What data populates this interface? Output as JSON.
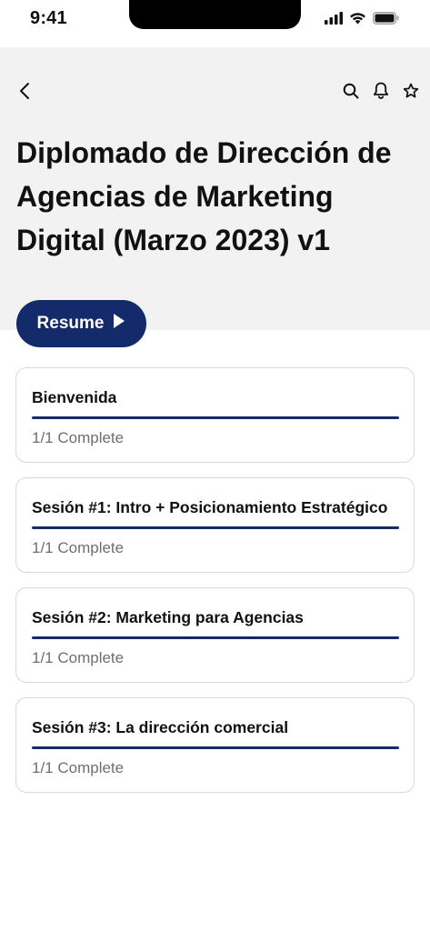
{
  "status_bar": {
    "time": "9:41"
  },
  "nav": {
    "back_icon": "chevron-left-icon",
    "actions": [
      {
        "icon": "search-icon"
      },
      {
        "icon": "bell-icon"
      },
      {
        "icon": "star-icon"
      }
    ]
  },
  "course": {
    "title": "Diplomado de Dirección de Agencias de Marketing Digital (Marzo 2023) v1"
  },
  "resume_button": {
    "label": "Resume",
    "icon": "play-icon",
    "color": "#132b6b"
  },
  "modules": [
    {
      "title": "Bienvenida",
      "status": "1/1 Complete",
      "progress": 1.0
    },
    {
      "title": "Sesión #1: Intro + Posicionamiento Estratégico",
      "status": "1/1 Complete",
      "progress": 1.0
    },
    {
      "title": "Sesión #2: Marketing para Agencias",
      "status": "1/1 Complete",
      "progress": 1.0
    },
    {
      "title": "Sesión #3: La dirección comercial",
      "status": "1/1 Complete",
      "progress": 1.0
    }
  ]
}
